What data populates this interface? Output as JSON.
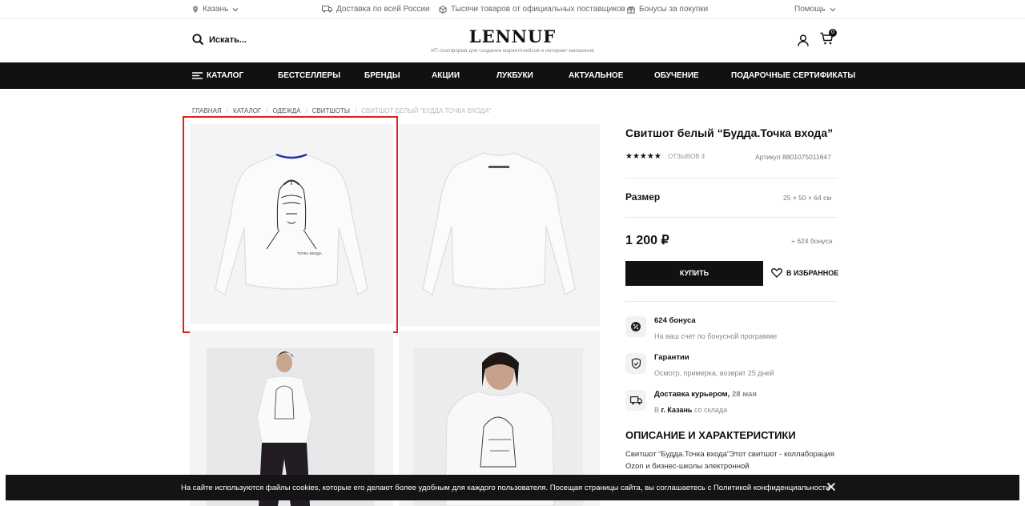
{
  "topbar": {
    "city": "Казань",
    "delivery": "Доставка по всей России",
    "suppliers": "Тысячи товаров от официальных поставщиков",
    "bonuses": "Бонусы за покупки",
    "help": "Помощь"
  },
  "header": {
    "search_label": "Искать...",
    "logo": "LENNUF",
    "tagline": "ИТ-платформа для создания маркетплейсов и интернет-магазинов",
    "cart_count": "0"
  },
  "nav": {
    "items": [
      "КАТАЛОГ",
      "БЕСТСЕЛЛЕРЫ",
      "БРЕНДЫ",
      "АКЦИИ",
      "ЛУКБУКИ",
      "АКТУАЛЬНОЕ",
      "ОБУЧЕНИЕ",
      "ПОДАРОЧНЫЕ СЕРТИФИКАТЫ"
    ]
  },
  "breadcrumbs": [
    "ГЛАВНАЯ",
    "КАТАЛОГ",
    "ОДЕЖДА",
    "СВИТШОТЫ",
    "СВИТШОТ БЕЛЫЙ \"БУДДА.ТОЧКА ВХОДА\""
  ],
  "product": {
    "title": "Свитшот белый “Будда.Точка входа”",
    "rating": 5,
    "stars": "★★★★★",
    "reviews": "ОТЗЫВОВ 4",
    "sku": "Артикул 8801075011647",
    "size_label": "Размер",
    "size_value": "25 × 50 × 64 см",
    "price": "1 200 ₽",
    "bonus": "+ 624 бонуса",
    "buy_label": "КУПИТЬ",
    "favorite_label": "В ИЗБРАННОЕ"
  },
  "features": [
    {
      "title": "624 бонуса",
      "title_extra": "",
      "subtitle": "На ваш счет по бонусной программе",
      "icon": "percent-badge-icon"
    },
    {
      "title": "Гарантии",
      "title_extra": "",
      "subtitle": "Осмотр, примерка, возврат 25 дней",
      "icon": "shield-check-icon"
    },
    {
      "title": "Доставка курьером,",
      "title_extra": "28 мая",
      "subtitle_prefix": "В",
      "subtitle_city": "г. Казань",
      "subtitle": "со склада",
      "icon": "truck-icon"
    }
  ],
  "description": {
    "heading": "ОПИСАНИЕ И ХАРАКТЕРИСТИКИ",
    "text": "Свитшот “Будда.Точка входа”Этот свитшот - коллаборация Ozon и бизнес-школы электронной"
  },
  "gallery": {
    "print_caption": "ТОЧКА ВХОДА",
    "image_count": 4
  },
  "cookie": {
    "text": "На сайте используются файлы cookies, которые его делают более удобным для каждого пользователя. Посещая страницы сайта, вы соглашаетесь с Политикой конфиденциальности"
  },
  "colors": {
    "nav_bg": "#111111",
    "highlight": "#e01f1f",
    "tile_bg": "#f4f4f4"
  }
}
